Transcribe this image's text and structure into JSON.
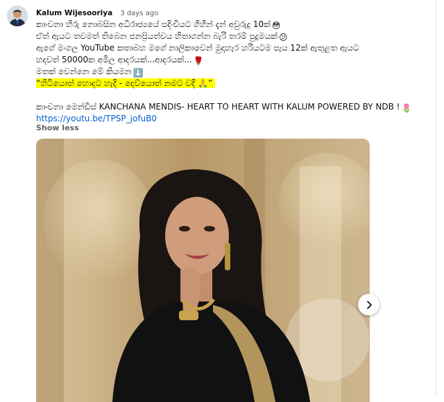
{
  "post": {
    "author": "Kalum Wijesooriya",
    "time": "3 days ago",
    "lines": {
      "l1": "කාංචනා හිරු නොබසින අධිරාජ්‍යයේ පදිංචියට ගිහින් දැන් අවුරුදු 10ක්",
      "l2": "ඒත් ඇයට තවමත් තිබෙන ජනප්‍රියත්වය හිතාගන්න බැරි තරම් පුදුමයක්",
      "l3": "ඇගේ මංගල YouTube කතාබහ මගේ නාලිකාවෙන් මුදාහැර හරියටම පැය 12ක් ඇතුළත ඇයට",
      "l4": "හදවත් 50000ක අමිල ආදරයක්...ආදරයක්...",
      "l5": "මතක් වෙන්නෙ මේ කියමන",
      "quote": "“හිටියොත් හොදට හැදී - දෙව්යොත් නමට වදී 🙏”",
      "title": "කාංචනා මෙන්ඩිස් KANCHANA MENDIS- HEART TO HEART WITH KALUM POWERED BY NDB !"
    },
    "link": "https://youtu.be/TPSP_jofuB0",
    "show_less": "Show less",
    "emoji": {
      "smile": "😳",
      "think": "😕",
      "rose": "🌹",
      "down_arrow": "⬇️",
      "tulip": "🌷"
    }
  },
  "colors": {
    "link": "#065fd4",
    "highlight": "#ffff00",
    "meta": "#606060"
  },
  "icons": {
    "next": "chevron-right-icon"
  }
}
